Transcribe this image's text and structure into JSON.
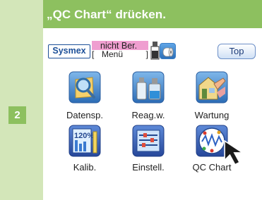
{
  "instruction": "„QC Chart“ drücken.",
  "step_number": "2",
  "topbar": {
    "logo": "Sysmex",
    "status_line1": "nicht Ber.",
    "status_bracket_left": "[",
    "status_line2": "Menü",
    "status_bracket_right": "]",
    "top_button": "Top"
  },
  "menu": {
    "items": [
      {
        "label": "Datensp.",
        "icon": "magnifier-icon"
      },
      {
        "label": "Reag.w.",
        "icon": "reagent-bottles-icon"
      },
      {
        "label": "Wartung",
        "icon": "maintenance-icon"
      },
      {
        "label": "Kalib.",
        "icon": "calibration-icon"
      },
      {
        "label": "Einstell.",
        "icon": "settings-icon"
      },
      {
        "label": "QC Chart",
        "icon": "qc-chart-icon"
      }
    ]
  },
  "colors": {
    "accent_green": "#8dc05f",
    "light_green": "#d3e6b9",
    "status_pink": "#ef9ed0",
    "logo_blue": "#1c4f98"
  }
}
